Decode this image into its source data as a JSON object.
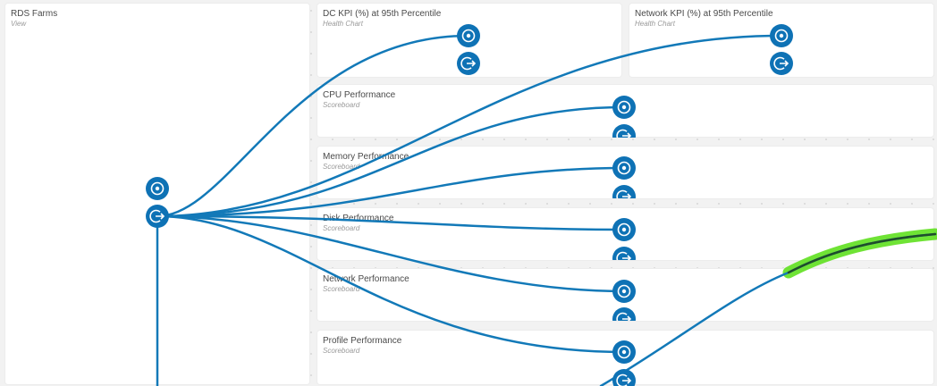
{
  "view": {
    "title": "RDS Farms",
    "type": "View"
  },
  "widgets": [
    {
      "title": "DC KPI (%) at 95th Percentile",
      "type": "Health Chart"
    },
    {
      "title": "Network KPI (%) at 95th Percentile",
      "type": "Health Chart"
    },
    {
      "title": "CPU Performance",
      "type": "Scoreboard"
    },
    {
      "title": "Memory Performance",
      "type": "Scoreboard"
    },
    {
      "title": "Disk Performance",
      "type": "Scoreboard"
    },
    {
      "title": "Network Performance",
      "type": "Scoreboard"
    },
    {
      "title": "Profile Performance",
      "type": "Scoreboard"
    }
  ],
  "colors": {
    "wire": "#1279b8",
    "node": "#0e72b5",
    "highlight": "#5fe01f",
    "canvas": "#f2f2f2"
  },
  "icons": {
    "input_node": "target-icon",
    "output_node": "arrow-out-icon"
  }
}
